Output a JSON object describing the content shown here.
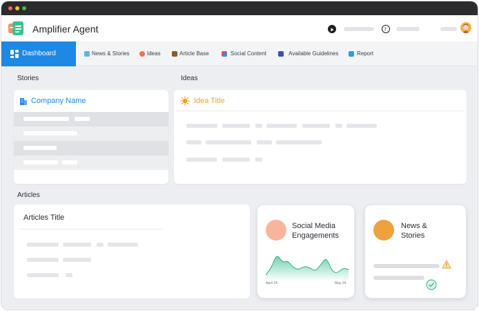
{
  "app": {
    "title": "Amplifier Agent"
  },
  "nav": {
    "active_label": "Dashboard",
    "items": [
      {
        "label": "News & Stories",
        "icon": "news-icon"
      },
      {
        "label": "Ideas",
        "icon": "idea-icon"
      },
      {
        "label": "Article Base",
        "icon": "article-icon"
      },
      {
        "label": "Social Content",
        "icon": "social-icon"
      },
      {
        "label": "Available Guidelines",
        "icon": "guidelines-icon"
      },
      {
        "label": "Report",
        "icon": "report-icon"
      }
    ]
  },
  "sections": {
    "stories": "Stories",
    "ideas": "Ideas",
    "articles": "Articles"
  },
  "stories_card": {
    "company_name": "Company Name"
  },
  "ideas_card": {
    "idea_title": "Idea Title"
  },
  "articles_card": {
    "title": "Articles Title"
  },
  "social_card": {
    "title_line1": "Social Media",
    "title_line2": "Engagements",
    "date_start": "April 24",
    "date_end": "May 24",
    "chart_values": [
      2,
      6,
      14,
      9,
      10,
      6,
      5,
      7,
      6,
      4,
      8,
      12,
      4,
      3,
      6,
      5
    ]
  },
  "news_card": {
    "title_line1": "News &",
    "title_line2": "Stories"
  },
  "colors": {
    "accent": "#1e88e5",
    "idea": "#f5a023",
    "social_circle": "#f8b59c",
    "news_circle": "#efa13e",
    "chart": "#46c49a",
    "warning": "#f0a030",
    "success": "#3cc48e"
  }
}
